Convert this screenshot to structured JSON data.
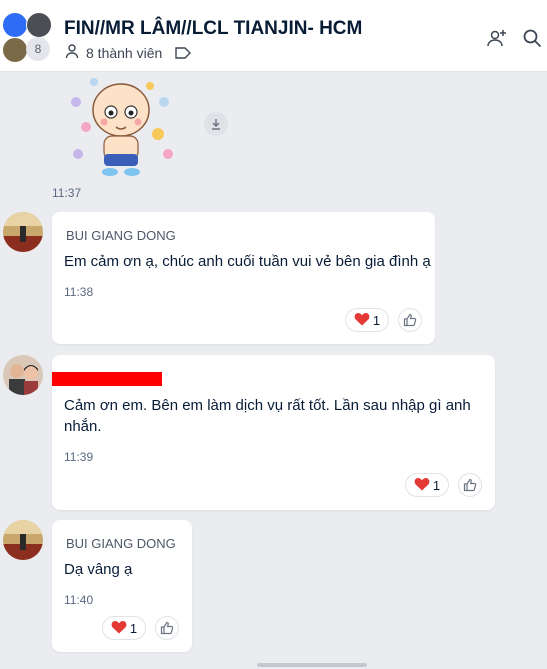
{
  "header": {
    "title": "FIN//MR LÂM//LCL TIANJIN- HCM",
    "member_count_badge": "8",
    "members_label": "8 thành viên"
  },
  "sticker": {
    "time": "11:37"
  },
  "messages": [
    {
      "sender": "BUI GIANG DONG",
      "lines": [
        "Em cảm ơn ạ, chúc anh cuối tuần vui vẻ bên gia đình ạ"
      ],
      "time": "11:38",
      "reaction_count": "1"
    },
    {
      "sender": "",
      "lines": [
        "Cảm ơn em. Bên em làm dịch vụ rất tốt. Lần sau nhập gì anh",
        "nhắn."
      ],
      "time": "11:39",
      "reaction_count": "1"
    },
    {
      "sender": "BUI GIANG DONG",
      "lines": [
        "Dạ vâng ạ"
      ],
      "time": "11:40",
      "reaction_count": "1"
    }
  ],
  "colors": {
    "accent_heart": "#e53935",
    "background": "#ebecf0",
    "redaction": "#ff0000"
  },
  "icons": [
    "user-icon",
    "tag-icon",
    "add-member-icon",
    "search-icon",
    "download-icon",
    "heart-icon",
    "thumbs-up-icon"
  ]
}
